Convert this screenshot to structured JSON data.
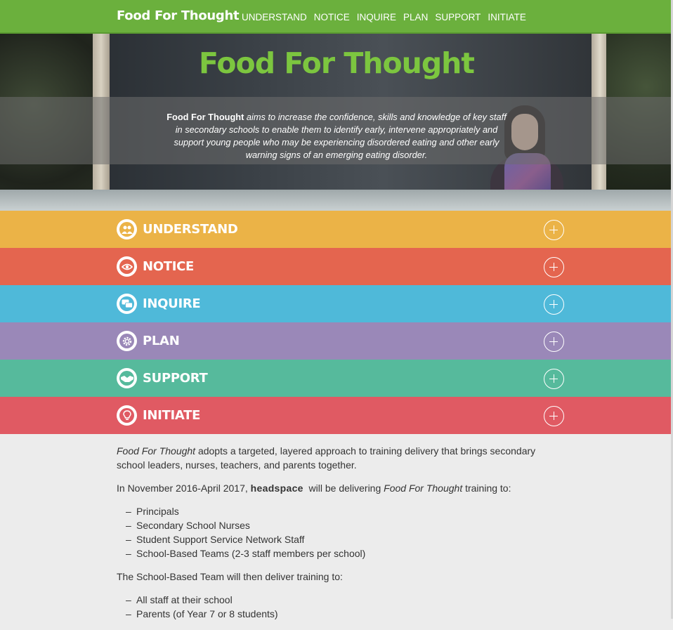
{
  "nav": {
    "brand": "Food For Thought",
    "links": [
      "UNDERSTAND",
      "NOTICE",
      "INQUIRE",
      "PLAN",
      "SUPPORT",
      "INITIATE"
    ]
  },
  "hero": {
    "title": "Food For Thought",
    "intro_bold": "Food For Thought",
    "intro_text": " aims to increase the confidence, skills and knowledge of key staff in secondary schools to enable them to identify early, intervene appropriately and support young people who may be experiencing disordered eating and other early warning signs of an emerging eating disorder."
  },
  "sections": [
    {
      "label": "UNDERSTAND",
      "icon": "people-icon",
      "color": "#ebb347"
    },
    {
      "label": "NOTICE",
      "icon": "eye-icon",
      "color": "#e4654f"
    },
    {
      "label": "INQUIRE",
      "icon": "chat-icon",
      "color": "#4fb9d9"
    },
    {
      "label": "PLAN",
      "icon": "gear-icon",
      "color": "#9a88b8"
    },
    {
      "label": "SUPPORT",
      "icon": "handshake-icon",
      "color": "#56ba9c"
    },
    {
      "label": "INITIATE",
      "icon": "lightbulb-icon",
      "color": "#e05a63"
    }
  ],
  "content": {
    "p1_em": "Food For Thought",
    "p1_text": " adopts a targeted, layered approach to training delivery that brings secondary school leaders, nurses, teachers, and parents together.",
    "p2_a": "In November 2016-April 2017, ",
    "p2_bold": "headspace",
    "p2_b": "  will be delivering ",
    "p2_em": "Food For Thought",
    "p2_c": " training to:",
    "list1": [
      "Principals",
      "Secondary School Nurses",
      "Student Support Service Network Staff",
      "School-Based Teams (2-3 staff members per school)"
    ],
    "p3": "The School-Based Team will then deliver training to:",
    "list2": [
      "All staff at their school",
      "Parents (of Year 7 or 8 students)"
    ]
  }
}
